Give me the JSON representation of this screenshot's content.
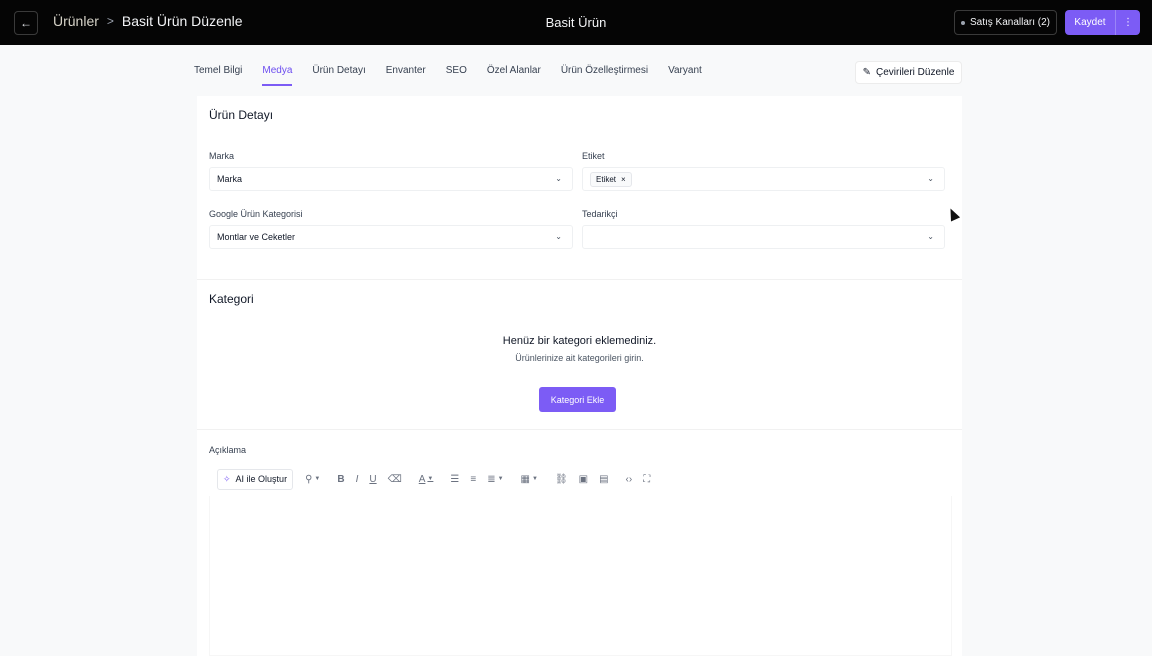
{
  "header": {
    "back_icon": "arrow-left-icon",
    "breadcrumb_parent": "Ürünler",
    "breadcrumb_separator": ">",
    "breadcrumb_current": "Basit Ürün Düzenle",
    "title": "Basit Ürün",
    "channels_label": "Satış Kanalları (2)",
    "save_label": "Kaydet",
    "more_icon": "more-vertical-icon"
  },
  "tabs": [
    {
      "label": "Temel Bilgi",
      "active": false
    },
    {
      "label": "Medya",
      "active": true
    },
    {
      "label": "Ürün Detayı",
      "active": false
    },
    {
      "label": "Envanter",
      "active": false
    },
    {
      "label": "SEO",
      "active": false
    },
    {
      "label": "Özel Alanlar",
      "active": false
    },
    {
      "label": "Ürün Özelleştirmesi",
      "active": false
    },
    {
      "label": "Varyant",
      "active": false
    }
  ],
  "translations_button": "Çevirileri Düzenle",
  "product_detail": {
    "title": "Ürün Detayı",
    "brand_label": "Marka",
    "brand_value": "Marka",
    "tag_label": "Etiket",
    "tag_chip": "Etiket",
    "google_category_label": "Google Ürün Kategorisi",
    "google_category_value": "Montlar ve Ceketler",
    "supplier_label": "Tedarikçi",
    "supplier_value": ""
  },
  "category": {
    "title": "Kategori",
    "empty_title": "Henüz bir kategori eklemediniz.",
    "empty_subtitle": "Ürünlerinize ait kategorileri girin.",
    "add_button": "Kategori Ekle"
  },
  "description": {
    "label": "Açıklama",
    "ai_button": "AI ile Oluştur"
  },
  "colors": {
    "accent": "#7c5cf5",
    "topbar": "#050505"
  }
}
